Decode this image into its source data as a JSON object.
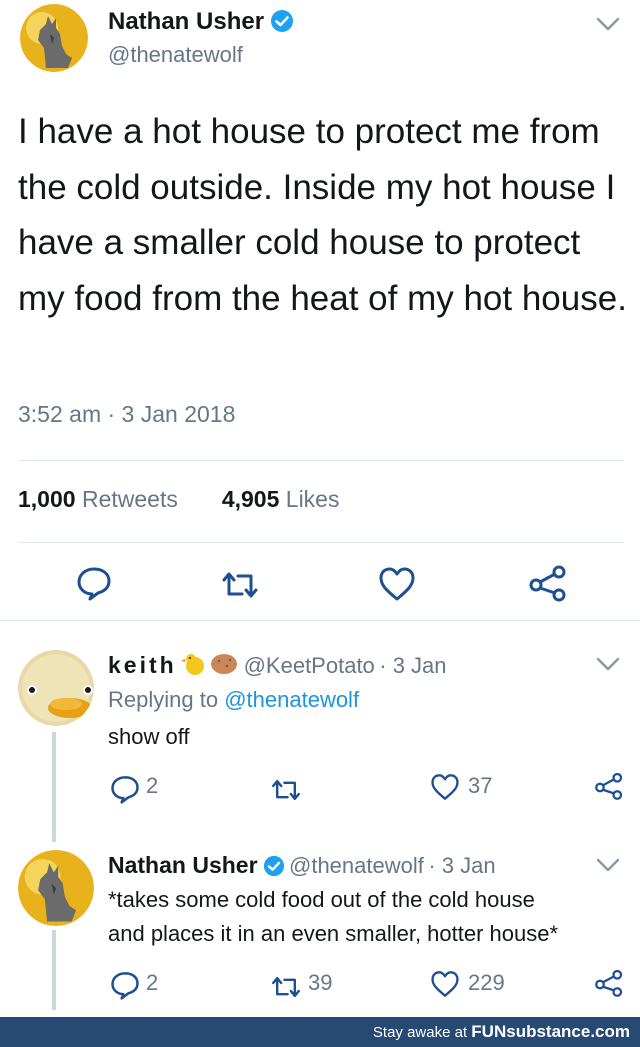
{
  "main_tweet": {
    "name": "Nathan Usher",
    "handle": "@thenatewolf",
    "text": "I have a hot house to protect me from the cold outside. Inside my hot house I have a smaller cold house to protect my food from the heat of my hot house.",
    "timestamp": "3:52 am · 3 Jan 2018",
    "retweets_count": "1,000",
    "retweets_label": "Retweets",
    "likes_count": "4,905",
    "likes_label": "Likes"
  },
  "replies": [
    {
      "name": "keith",
      "handle": "@KeetPotato",
      "date": "· 3 Jan",
      "replying_prefix": "Replying to",
      "replying_handle": "@thenatewolf",
      "text": "show off",
      "reply_count": "2",
      "retweet_count": "",
      "like_count": "37"
    },
    {
      "name": "Nathan Usher",
      "handle": "@thenatewolf",
      "date": "· 3 Jan",
      "text_line1": "*takes some cold food out of the cold house",
      "text_line2": "and places it in an even smaller, hotter house*",
      "reply_count": "2",
      "retweet_count": "39",
      "like_count": "229"
    }
  ],
  "footer": {
    "prefix": "Stay awake at",
    "brand": "FUNsubstance.com"
  },
  "colors": {
    "text": "#14171a",
    "secondary": "#657786",
    "link": "#1b95e0",
    "verified": "#1da1f2",
    "divider": "#e1e8ed",
    "footer_bg": "#274a74"
  }
}
